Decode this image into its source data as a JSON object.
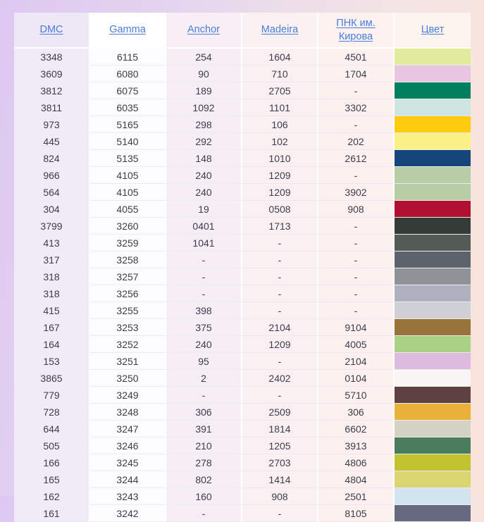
{
  "theme": {
    "page_gradient_from": "#ddc9f0",
    "page_gradient_to": "#fae3d9",
    "header_link_color": "#4a7cdc",
    "body_text_color": "#3c3c4e",
    "grid_line_color": "#ffffff"
  },
  "table": {
    "name": "thread-conversion-table",
    "columns": [
      {
        "key": "dmc",
        "label": "DMC",
        "link": true
      },
      {
        "key": "gamma",
        "label": "Gamma",
        "link": true
      },
      {
        "key": "anchor",
        "label": "Anchor",
        "link": true
      },
      {
        "key": "madeira",
        "label": "Madeira",
        "link": true
      },
      {
        "key": "pnk",
        "label": "ПНК им. Кирова",
        "link": true
      },
      {
        "key": "color",
        "label": "Цвет",
        "link": true
      }
    ],
    "rows": [
      {
        "dmc": "3348",
        "gamma": "6115",
        "anchor": "254",
        "madeira": "1604",
        "pnk": "4501",
        "color": "#e0eb9b"
      },
      {
        "dmc": "3609",
        "gamma": "6080",
        "anchor": "90",
        "madeira": "710",
        "pnk": "1704",
        "color": "#e8c6e1"
      },
      {
        "dmc": "3812",
        "gamma": "6075",
        "anchor": "189",
        "madeira": "2705",
        "pnk": "-",
        "color": "#00805e"
      },
      {
        "dmc": "3811",
        "gamma": "6035",
        "anchor": "1092",
        "madeira": "1101",
        "pnk": "3302",
        "color": "#cde5de"
      },
      {
        "dmc": "973",
        "gamma": "5165",
        "anchor": "298",
        "madeira": "106",
        "pnk": "-",
        "color": "#fecb0d"
      },
      {
        "dmc": "445",
        "gamma": "5140",
        "anchor": "292",
        "madeira": "102",
        "pnk": "202",
        "color": "#f9f183"
      },
      {
        "dmc": "824",
        "gamma": "5135",
        "anchor": "148",
        "madeira": "1010",
        "pnk": "2612",
        "color": "#14457b"
      },
      {
        "dmc": "966",
        "gamma": "4105",
        "anchor": "240",
        "madeira": "1209",
        "pnk": "-",
        "color": "#b8cda6"
      },
      {
        "dmc": "564",
        "gamma": "4105",
        "anchor": "240",
        "madeira": "1209",
        "pnk": "3902",
        "color": "#b8cda6"
      },
      {
        "dmc": "304",
        "gamma": "4055",
        "anchor": "19",
        "madeira": "0508",
        "pnk": "908",
        "color": "#b00f2f"
      },
      {
        "dmc": "3799",
        "gamma": "3260",
        "anchor": "0401",
        "madeira": "1713",
        "pnk": "-",
        "color": "#343a36"
      },
      {
        "dmc": "413",
        "gamma": "3259",
        "anchor": "1041",
        "madeira": "-",
        "pnk": "-",
        "color": "#545a55"
      },
      {
        "dmc": "317",
        "gamma": "3258",
        "anchor": "-",
        "madeira": "-",
        "pnk": "-",
        "color": "#5b646c"
      },
      {
        "dmc": "318",
        "gamma": "3257",
        "anchor": "-",
        "madeira": "-",
        "pnk": "-",
        "color": "#8f9296"
      },
      {
        "dmc": "318",
        "gamma": "3256",
        "anchor": "-",
        "madeira": "-",
        "pnk": "-",
        "color": "#aeb1bd"
      },
      {
        "dmc": "415",
        "gamma": "3255",
        "anchor": "398",
        "madeira": "-",
        "pnk": "-",
        "color": "#ced0d5"
      },
      {
        "dmc": "167",
        "gamma": "3253",
        "anchor": "375",
        "madeira": "2104",
        "pnk": "9104",
        "color": "#98733a"
      },
      {
        "dmc": "164",
        "gamma": "3252",
        "anchor": "240",
        "madeira": "1209",
        "pnk": "4005",
        "color": "#a9d186"
      },
      {
        "dmc": "153",
        "gamma": "3251",
        "anchor": "95",
        "madeira": "-",
        "pnk": "2104",
        "color": "#dcbbdf"
      },
      {
        "dmc": "3865",
        "gamma": "3250",
        "anchor": "2",
        "madeira": "2402",
        "pnk": "0104",
        "color": "#f8f7f3"
      },
      {
        "dmc": "779",
        "gamma": "3249",
        "anchor": "-",
        "madeira": "-",
        "pnk": "5710",
        "color": "#5d4242"
      },
      {
        "dmc": "728",
        "gamma": "3248",
        "anchor": "306",
        "madeira": "2509",
        "pnk": "306",
        "color": "#e8b13a"
      },
      {
        "dmc": "644",
        "gamma": "3247",
        "anchor": "391",
        "madeira": "1814",
        "pnk": "6602",
        "color": "#d4d3c3"
      },
      {
        "dmc": "505",
        "gamma": "3246",
        "anchor": "210",
        "madeira": "1205",
        "pnk": "3913",
        "color": "#4a7d5b"
      },
      {
        "dmc": "166",
        "gamma": "3245",
        "anchor": "278",
        "madeira": "2703",
        "pnk": "4806",
        "color": "#c2c231"
      },
      {
        "dmc": "165",
        "gamma": "3244",
        "anchor": "802",
        "madeira": "1414",
        "pnk": "4804",
        "color": "#d9d571"
      },
      {
        "dmc": "162",
        "gamma": "3243",
        "anchor": "160",
        "madeira": "908",
        "pnk": "2501",
        "color": "#d1e4ef"
      },
      {
        "dmc": "161",
        "gamma": "3242",
        "anchor": "-",
        "madeira": "-",
        "pnk": "8105",
        "color": "#676981"
      }
    ]
  }
}
